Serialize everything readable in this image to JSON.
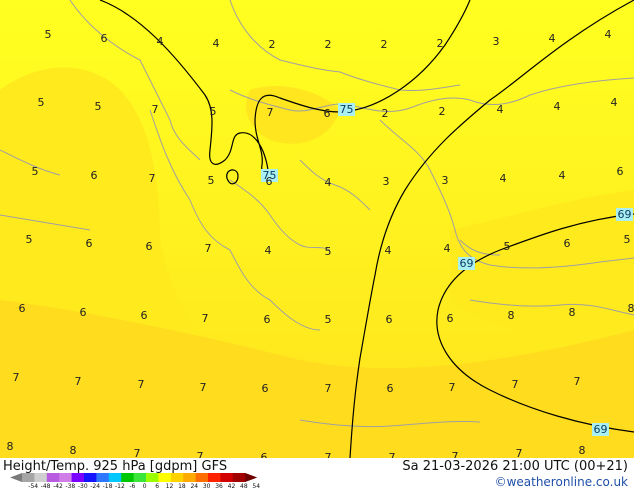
{
  "title": "Height/Temp. 925 hPa [gdpm] GFS",
  "datetime": "Sa 21-03-2026 21:00 UTC (00+21)",
  "credit": "©weatheronline.co.uk",
  "colors": {
    "field_light": "#FFFF20",
    "field_mid": "#FFEA1E",
    "field_dark": "#FFD21E",
    "coast": "#A0A0A0",
    "contour": "#000000",
    "label_box": "#AAF0F0"
  },
  "colorbar": {
    "labels": [
      "-54",
      "-48",
      "-42",
      "-38",
      "-30",
      "-24",
      "-18",
      "-12",
      "-6",
      "0",
      "6",
      "12",
      "18",
      "24",
      "30",
      "36",
      "42",
      "48",
      "54"
    ],
    "colors": [
      "#7a7a7a",
      "#a5a5a5",
      "#cfcfcf",
      "#b95be0",
      "#d07de8",
      "#7a00ff",
      "#1414ff",
      "#2f77ff",
      "#00c8ff",
      "#00c800",
      "#39e639",
      "#9bff00",
      "#ffff00",
      "#ffd200",
      "#ffaa00",
      "#ff6e00",
      "#ff2200",
      "#d20000",
      "#a00000",
      "#6e0000"
    ]
  },
  "isohypse_labels": [
    "75",
    "75",
    "69",
    "69",
    "69"
  ],
  "temperature_grid": [
    [
      "5",
      "6",
      "4",
      "4",
      "2",
      "2",
      "2",
      "2",
      "3",
      "4",
      "4"
    ],
    [
      "5",
      "5",
      "7",
      "5",
      "7",
      "6",
      "2",
      "2",
      "4",
      "4",
      "4"
    ],
    [
      "5",
      "6",
      "7",
      "5",
      "6",
      "4",
      "3",
      "3",
      "4",
      "4",
      "6"
    ],
    [
      "5",
      "6",
      "6",
      "7",
      "4",
      "5",
      "4",
      "4",
      "5",
      "6",
      "5"
    ],
    [
      "6",
      "6",
      "6",
      "7",
      "6",
      "5",
      "6",
      "6",
      "8",
      "8",
      "8"
    ],
    [
      "7",
      "7",
      "7",
      "7",
      "6",
      "7",
      "6",
      "7",
      "7",
      "7"
    ],
    [
      "8",
      "8",
      "7",
      "7",
      "6",
      "7",
      "7",
      "7",
      "7",
      "8"
    ]
  ]
}
